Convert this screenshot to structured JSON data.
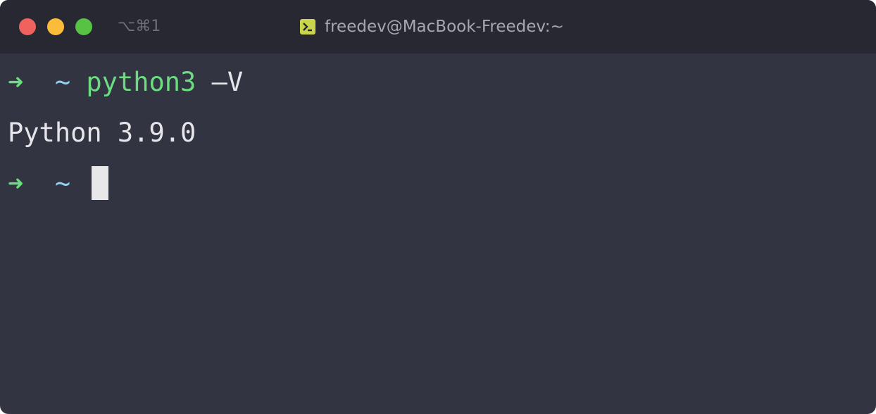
{
  "window": {
    "shortcut": "⌥⌘1",
    "title": "freedev@MacBook-Freedev:~",
    "title_icon": "terminal-icon"
  },
  "terminal": {
    "lines": [
      {
        "prompt_arrow": "➜",
        "cwd": "~",
        "command": "python3",
        "args": "–V"
      },
      {
        "output": "Python 3.9.0"
      },
      {
        "prompt_arrow": "➜",
        "cwd": "~",
        "command": ""
      }
    ]
  },
  "colors": {
    "close": "#f0625d",
    "minimize": "#fbbc3a",
    "zoom": "#58c245",
    "background": "#323441",
    "titlebar": "#272831",
    "prompt": "#6bdc80",
    "cwd": "#8fd3f5",
    "text": "#e6e6ea"
  }
}
